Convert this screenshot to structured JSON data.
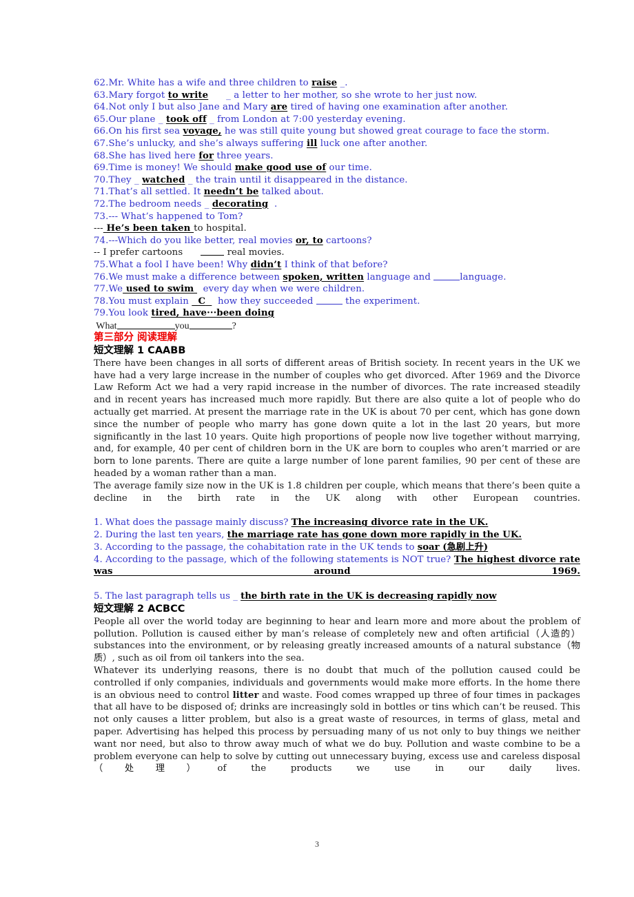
{
  "document": {
    "page_number": "3",
    "colors": {
      "exercise_blue": "#3333cc",
      "heading_red": "#ee0000",
      "body_black": "#1a1a1a",
      "answer_black": "#000000"
    }
  },
  "exercises": {
    "items": [
      {
        "number": "62.",
        "pre": "Mr. White has a wife and three children to ",
        "answer": "raise",
        "post": " _."
      },
      {
        "number": "63.",
        "pre": "Mary forgot ",
        "answer": "to write",
        "post": "      _ a letter to her mother, so she wrote to her just now."
      },
      {
        "number": "64.",
        "pre": "Not only I but also Jane and Mary ",
        "answer": "are",
        "post": " tired of having one examination after another."
      },
      {
        "number": "65.",
        "pre": "Our plane _ ",
        "answer": "took off",
        "post": " _ from London at 7:00 yesterday evening."
      },
      {
        "number": "66.",
        "pre": "On his first sea ",
        "answer": "voyage,",
        "post": " he was still quite young but showed great courage to face the storm."
      },
      {
        "number": "67.",
        "pre": "She’s unlucky, and she’s always suffering ",
        "answer": "ill",
        "post": " luck one after another."
      },
      {
        "number": "68.",
        "pre": "She has lived here ",
        "answer": "for",
        "post": " three years."
      },
      {
        "number": "69.",
        "pre": "Time is money! We should ",
        "answer": "make good use of",
        "post": " our time."
      },
      {
        "number": "70.",
        "pre": "They _ ",
        "answer": "watched",
        "post": " _ the train until it disappeared in the distance."
      },
      {
        "number": "71.",
        "pre": "That’s all settled. It ",
        "answer": "needn’t be",
        "post": " talked about."
      },
      {
        "number": "72.",
        "pre": "The bedroom needs _ ",
        "answer": "decorating",
        "post": "  ."
      },
      {
        "number": "73.",
        "pre": "--- What’s happened to Tom?",
        "answer": "",
        "post": ""
      }
    ],
    "line73b": {
      "prefix": "---",
      "answer": " He’s been taken ",
      "post": "to hospital."
    },
    "item74": {
      "number": "74.",
      "pre": "---Which do you like better, real movies ",
      "answer": "or, to",
      "post": " cartoons?"
    },
    "item74b": {
      "text_pre": "-- I prefer cartoons      ",
      "text_post": " real movies."
    },
    "item75": {
      "number": "75.",
      "pre": "What a fool I have been! Why ",
      "answer": "didn’t",
      "post": " I think of that before?"
    },
    "item76": {
      "number": "76.",
      "pre": "We must make a difference between ",
      "answer": "spoken, written",
      "post_a": " language and ",
      "post_b": "language."
    },
    "item77": {
      "number": "77.",
      "pre": "We",
      "answer": " used to swim ",
      "post": "  every day when we were children."
    },
    "item78": {
      "number": "78.",
      "pre": "You must explain ",
      "answer": "C",
      "mid": "  how they succeeded ",
      "post": " the experiment."
    },
    "item79": {
      "number": "79.",
      "pre": "You look ",
      "answer": "tired, have···been doing"
    },
    "handwriting": {
      "a": "What",
      "b": "you",
      "c": "?"
    }
  },
  "part3": {
    "red_heading": "第三部分  阅读理解",
    "passage1": {
      "heading": "短文理解 1  CAABB",
      "paragraphs": [
        "There have been changes in all sorts of different areas of British society. In recent years in the UK we have had a very large increase in the number of couples who get divorced. After 1969 and the Divorce Law Reform Act we had a very rapid increase in the number of divorces. The rate increased steadily and in recent years has increased much more rapidly. But there are also quite a lot of people who do actually get married. At present the marriage rate in the UK is about 70 per cent, which has gone down since the number of people who marry has gone down quite a lot in the last 20 years, but more significantly in the last 10 years. Quite high proportions of people now live together without marrying, and, for example, 40 per cent of children born in the UK are born to couples who aren’t married or are born to lone parents. There are quite a large number of lone parent families, 90 per cent of these are headed by a woman rather than a man.",
        "The average family size now in the UK is 1.8 children per couple, which means that there’s been quite a decline in the birth rate in the UK along with other European countries."
      ],
      "questions": [
        {
          "number": "1.",
          "text": " What does the passage mainly discuss? ",
          "answer": "The increasing divorce rate in the UK."
        },
        {
          "number": "2.",
          "text": " During the last ten years, ",
          "answer": "the marriage rate has gone down more rapidly in the UK."
        },
        {
          "number": "3.",
          "text": " According to the passage, the cohabitation rate in the UK tends to ",
          "answer": "soar (急剧上升)"
        },
        {
          "number": "4.",
          "text": " According to the passage, which of the following statements is NOT true? ",
          "answer": "The highest divorce rate was around 1969."
        },
        {
          "number": "5.",
          "text": " The last paragraph tells us _ ",
          "answer": "the birth rate in the UK is decreasing rapidly now"
        }
      ]
    },
    "passage2": {
      "heading": "短文理解 2  ACBCC",
      "paragraphs": [
        "People all over the world today are beginning to hear and learn more and more about the problem of pollution. Pollution is caused either by man’s release of completely new and often artificial（人造的）substances into the environment, or by releasing greatly increased amounts of a natural substance（物质）, such as oil from oil tankers into the sea.",
        "Whatever its underlying reasons, there is no doubt that much of the pollution caused could be controlled if only companies, individuals and governments would make more efforts. In the home there is an obvious need to control <b>litter</b> and waste. Food comes wrapped up three of four times in packages that all have to be disposed of; drinks are increasingly sold in bottles or tins which can’t be reused. This not only causes a litter problem, but also is a great waste of resources, in terms of glass, metal and paper. Advertising has helped this process by persuading many of us not only to buy things we neither want nor need, but also to throw away much of what we do buy. Pollution and waste combine to be a problem everyone can help to solve by cutting out unnecessary buying, excess use and careless disposal（处理）of the products we use in our daily lives."
      ]
    }
  }
}
